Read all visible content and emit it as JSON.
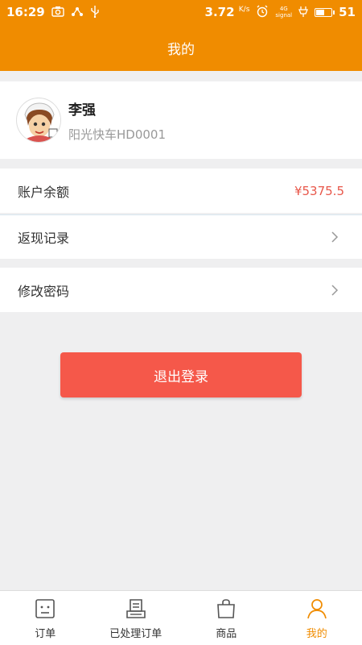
{
  "status_bar": {
    "time": "16:29",
    "speed": "3.72",
    "speed_unit": "K/s",
    "network_top": "4G",
    "network_bottom": "signal",
    "battery": "51"
  },
  "header": {
    "title": "我的"
  },
  "profile": {
    "name": "李强",
    "subtitle": "阳光快车HD0001"
  },
  "menu": {
    "balance_label": "账户余额",
    "balance_value": "¥5375.5",
    "cashback_label": "返现记录",
    "password_label": "修改密码"
  },
  "logout_label": "退出登录",
  "tabs": [
    {
      "label": "订单",
      "icon": "order-icon"
    },
    {
      "label": "已处理订单",
      "icon": "processed-orders-icon"
    },
    {
      "label": "商品",
      "icon": "shopping-bag-icon"
    },
    {
      "label": "我的",
      "icon": "user-icon"
    }
  ],
  "colors": {
    "accent": "#f08c00",
    "danger": "#f5584a",
    "balance": "#e8574a"
  }
}
